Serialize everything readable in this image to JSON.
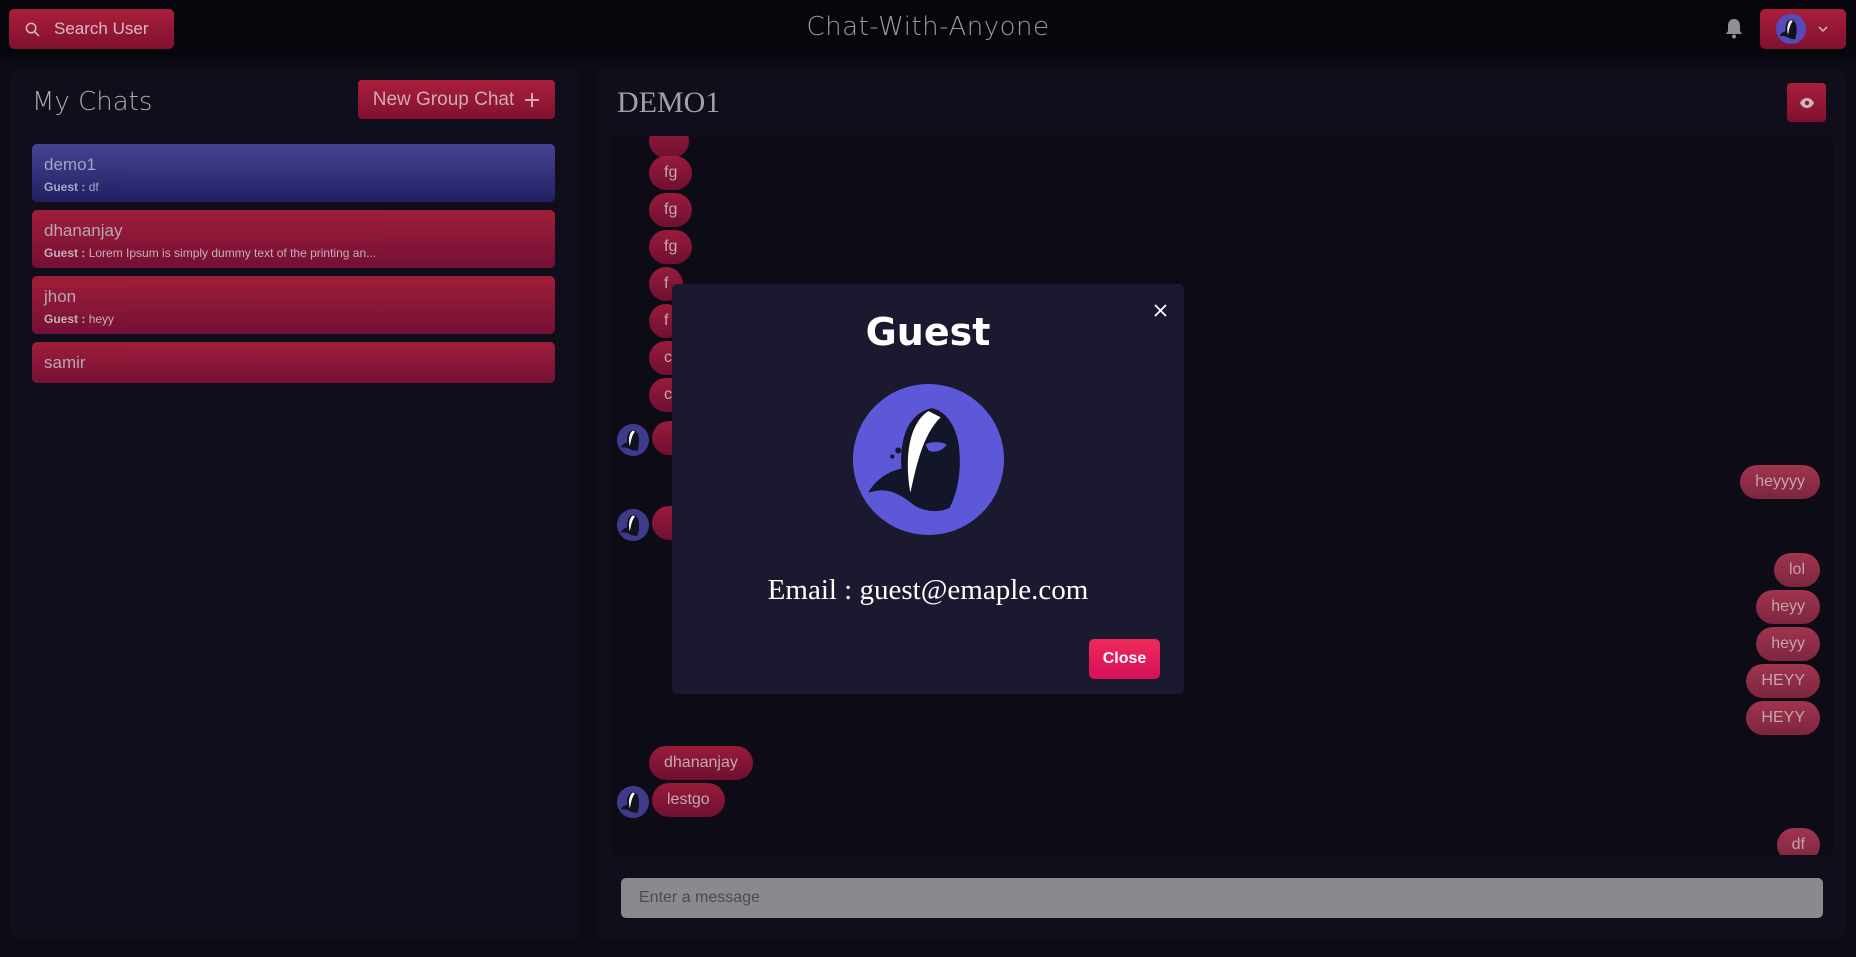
{
  "header": {
    "search_label": "Search User",
    "app_title": "Chat-With-Anyone"
  },
  "sidebar": {
    "title": "My Chats",
    "new_group_label": "New Group Chat",
    "chats": [
      {
        "name": "demo1",
        "sender": "Guest :",
        "latest": "df",
        "active": true
      },
      {
        "name": "dhananjay",
        "sender": "Guest :",
        "latest": "Lorem Ipsum is simply dummy text of the printing an...",
        "active": false
      },
      {
        "name": "jhon",
        "sender": "Guest :",
        "latest": "heyy",
        "active": false
      },
      {
        "name": "samir",
        "sender": "",
        "latest": "",
        "active": false
      }
    ]
  },
  "chat": {
    "title": "DEMO1",
    "messages": [
      {
        "text": "fg"
      },
      {
        "text": "fg"
      },
      {
        "text": "fg"
      },
      {
        "text": "f"
      },
      {
        "text": "f"
      },
      {
        "text": "c"
      },
      {
        "text": "c"
      },
      {
        "text": ""
      },
      {
        "text": "heyyyy"
      },
      {
        "text": ""
      },
      {
        "text": "lol"
      },
      {
        "text": "heyy"
      },
      {
        "text": "heyy"
      },
      {
        "text": "HEYY"
      },
      {
        "text": "HEYY"
      },
      {
        "text": "dhananjay"
      },
      {
        "text": "lestgo"
      },
      {
        "text": "df"
      }
    ],
    "input_placeholder": "Enter a message"
  },
  "modal": {
    "title": "Guest",
    "email_line": "Email : guest@emaple.com",
    "close_label": "Close"
  },
  "colors": {
    "accent": "#b8213f",
    "accent_dark": "#8b1134",
    "active_chat": "#4c4aa0",
    "modal_bg": "#1a1930",
    "avatar_bg": "#5d58d8",
    "close_btn": "#e8195c"
  },
  "icons": [
    "search-icon",
    "bell-icon",
    "chevron-down-icon",
    "plus-icon",
    "eye-icon",
    "close-icon",
    "hooded-avatar-icon"
  ]
}
